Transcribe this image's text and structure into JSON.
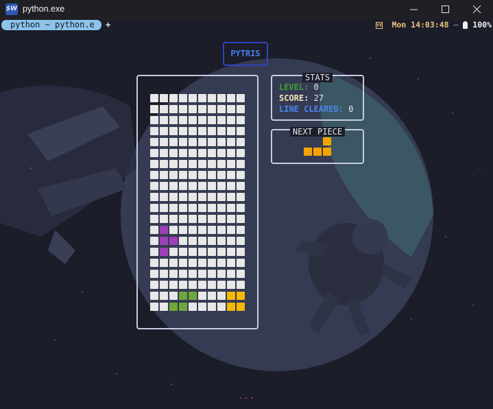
{
  "window": {
    "title": "python.exe",
    "icon": "terminal-app-icon",
    "icon_text": "$W",
    "controls": [
      "minimize-icon",
      "maximize-icon",
      "close-icon"
    ]
  },
  "terminal": {
    "tab_label": "python ~ python.e",
    "new_tab_label": "+",
    "status": {
      "datetime": "Mon 14:03:48",
      "separator": "—",
      "battery": "100%"
    }
  },
  "game": {
    "title": "PYTRIS",
    "stats": {
      "heading": "STATS",
      "level_label": "LEVEL:",
      "level_value": "0",
      "score_label": "SCORE:",
      "score_value": "27",
      "lines_label": "LINE CLEARED:",
      "lines_value": "0"
    },
    "next": {
      "heading": "NEXT PIECE",
      "piece_color": "#f5a300",
      "cells": [
        [
          0,
          2
        ],
        [
          1,
          0
        ],
        [
          1,
          1
        ],
        [
          1,
          2
        ]
      ]
    },
    "board": {
      "cols": 10,
      "rows": 20,
      "empty_color": "#e8e8e8",
      "filled": [
        {
          "r": 12,
          "c": 1,
          "color": "#9c3fb8"
        },
        {
          "r": 13,
          "c": 1,
          "color": "#9c3fb8"
        },
        {
          "r": 13,
          "c": 2,
          "color": "#9c3fb8"
        },
        {
          "r": 14,
          "c": 1,
          "color": "#9c3fb8"
        },
        {
          "r": 18,
          "c": 3,
          "color": "#6ea83a"
        },
        {
          "r": 18,
          "c": 4,
          "color": "#6ea83a"
        },
        {
          "r": 19,
          "c": 2,
          "color": "#6ea83a"
        },
        {
          "r": 19,
          "c": 3,
          "color": "#6ea83a"
        },
        {
          "r": 18,
          "c": 8,
          "color": "#f5b800"
        },
        {
          "r": 18,
          "c": 9,
          "color": "#f5b800"
        },
        {
          "r": 19,
          "c": 8,
          "color": "#f5b800"
        },
        {
          "r": 19,
          "c": 9,
          "color": "#f5b800"
        }
      ]
    },
    "footer_dots": "..."
  },
  "colors": {
    "level": "#3f9b3a",
    "score": "#f0e6b8",
    "lines": "#4a86e8"
  }
}
